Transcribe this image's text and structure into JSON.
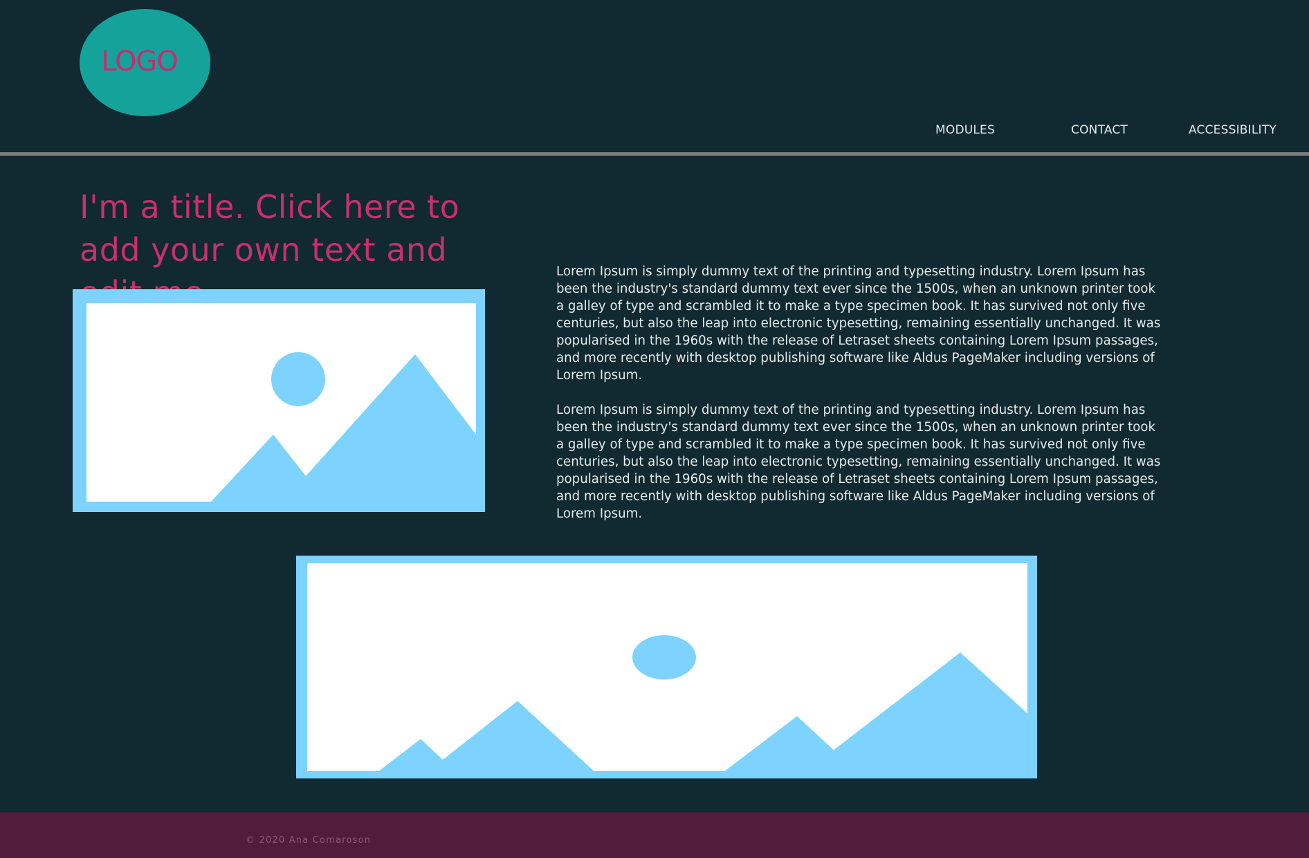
{
  "header": {
    "logo_text": "LOGO",
    "nav": [
      {
        "label": "MODULES"
      },
      {
        "label": "CONTACT"
      },
      {
        "label": "ACCESSIBILITY"
      }
    ]
  },
  "main": {
    "title": "I'm a title. Click here to add your own text and edit me.",
    "paragraphs": [
      "Lorem Ipsum is simply dummy text of the printing and typesetting industry. Lorem Ipsum has been the industry's standard dummy text ever since the 1500s, when an unknown printer took a galley of type and scrambled it to make a type specimen book. It has survived not only five centuries, but also the leap into electronic typesetting, remaining essentially unchanged. It was popularised in the 1960s with the release of Letraset sheets containing Lorem Ipsum passages, and more recently with desktop publishing software like Aldus PageMaker including versions of Lorem Ipsum.",
      "Lorem Ipsum is simply dummy text of the printing and typesetting industry. Lorem Ipsum has been the industry's standard dummy text ever since the 1500s, when an unknown printer took a galley of type and scrambled it to make a type specimen book. It has survived not only five centuries, but also the leap into electronic typesetting, remaining essentially unchanged. It was popularised in the 1960s with the release of Letraset sheets containing Lorem Ipsum passages, and more recently with desktop publishing software like Aldus PageMaker including versions of Lorem Ipsum."
    ],
    "images": [
      {
        "icon": "image-placeholder-icon"
      },
      {
        "icon": "image-placeholder-icon"
      }
    ]
  },
  "footer": {
    "copyright": "© 2020 Ana Comaroson"
  },
  "colors": {
    "background": "#112930",
    "logo": "#15a29b",
    "accent": "#c9306e",
    "placeholder": "#7dd3fe",
    "footer": "#521d3d"
  }
}
